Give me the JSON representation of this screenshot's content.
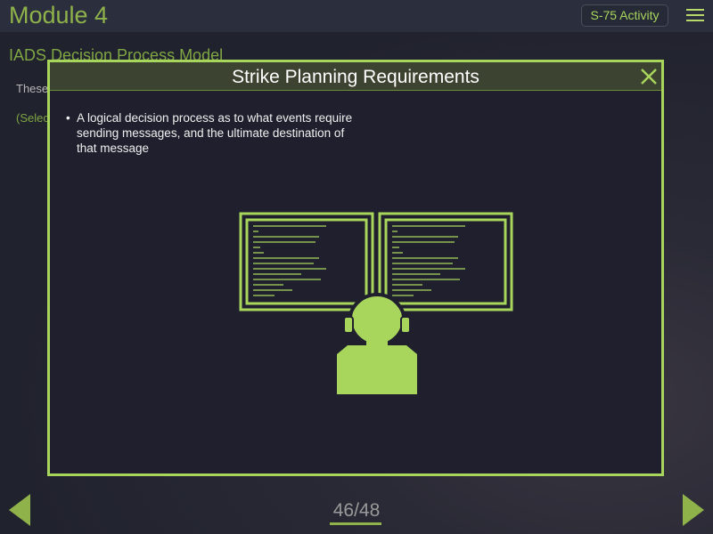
{
  "header": {
    "module_title": "Module 4",
    "activity_button": "S-75 Activity",
    "menu_icon": "hamburger-menu-icon"
  },
  "background": {
    "section_title": "IADS Decision Process Model",
    "body_text_partial": "These",
    "select_text_partial": "(Selec"
  },
  "modal": {
    "title": "Strike Planning Requirements",
    "close_icon": "close-icon",
    "bullet_text": "A logical decision process as to what events require sending messages, and the ultimate destination of that message",
    "illustration": "operator-at-dual-monitors-icon"
  },
  "footer": {
    "page_counter": "46/48",
    "prev_icon": "prev-arrow-icon",
    "next_icon": "next-arrow-icon"
  },
  "colors": {
    "accent": "#a8d65c",
    "accent_dark": "#8fb34a",
    "background": "#20222e",
    "modal_bg": "#1f1f2d"
  }
}
